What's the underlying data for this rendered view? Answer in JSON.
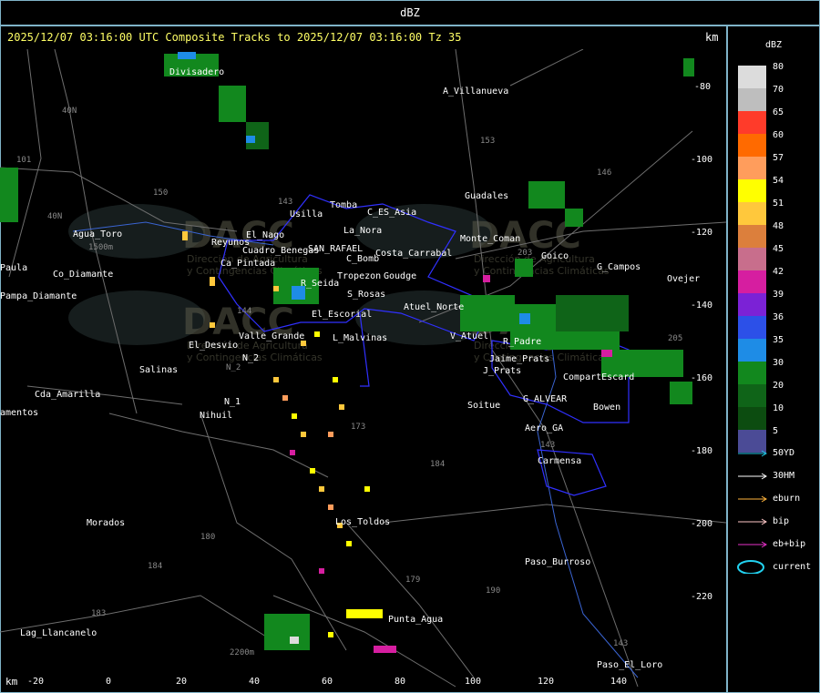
{
  "header": {
    "title": "dBZ"
  },
  "subtitle": "2025/12/07 03:16:00 UTC Composite Tracks to 2025/12/07 03:16:00 Tz 35",
  "axis": {
    "unit": "km",
    "x_ticks": [
      "-20",
      "0",
      "20",
      "40",
      "60",
      "80",
      "100",
      "120",
      "140"
    ],
    "y_ticks": [
      "-80",
      "-100",
      "-120",
      "-140",
      "-160",
      "-180",
      "-200",
      "-220"
    ]
  },
  "watermark": {
    "logo": "DACC",
    "line1": "Dirección de Agricultura",
    "line2": "y Contingencias Climáticas"
  },
  "places": [
    "A_Villanueva",
    "Guadales",
    "Goico",
    "G_Campos",
    "Ovejer",
    "Usilla",
    "Tomba",
    "La_Nora",
    "C_ES_Asia",
    "Cuadro_Benegas",
    "SAN_RAFAEL",
    "C_Bomb",
    "Costa_Carrabal",
    "Tropezon",
    "Goudge",
    "R_Seida",
    "S_Rosas",
    "Atuel_Norte",
    "El_Escorial",
    "Valle_Grande",
    "L_Malvinas",
    "V_Atuel",
    "R_Padre",
    "J_Prats",
    "CompartEscard",
    "G_ALVEAR",
    "Bowen",
    "Soitue",
    "Aero_GA",
    "Carmensa",
    "Los_Toldos",
    "Punta_Agua",
    "Paso_Burroso",
    "Paso_El_Loro",
    "Morados",
    "Lag_Llancanelo",
    "Agua_Toro",
    "Pampa_Diamante",
    "El_Desvio",
    "Salinas",
    "Cda_Amarilla",
    "Nihuil",
    "N_1",
    "N_2",
    "Reyunos",
    "El_Nago",
    "Ca_Pintada",
    "Divisadero",
    "Monte_Coman",
    "Jaime_Prats",
    "Paula",
    "amentos",
    "Co_Diamante"
  ],
  "roads": [
    "40N",
    "40N",
    "101",
    "150",
    "143",
    "153",
    "146",
    "203",
    "144",
    "173",
    "184",
    "179",
    "180",
    "184",
    "183",
    "190",
    "143",
    "205",
    "143",
    "2200m",
    "1500m",
    "N_2"
  ],
  "legend": {
    "title": "dBZ",
    "scale": [
      {
        "label": "80",
        "color": "#dcdcdc"
      },
      {
        "label": "70",
        "color": "#bebebe"
      },
      {
        "label": "65",
        "color": "#ff3b2a"
      },
      {
        "label": "60",
        "color": "#ff6a00"
      },
      {
        "label": "57",
        "color": "#ff9d5c"
      },
      {
        "label": "54",
        "color": "#ffff00"
      },
      {
        "label": "51",
        "color": "#ffc83c"
      },
      {
        "label": "48",
        "color": "#dc7f3c"
      },
      {
        "label": "45",
        "color": "#c86e8c"
      },
      {
        "label": "42",
        "color": "#d61ea0"
      },
      {
        "label": "39",
        "color": "#7b22d6"
      },
      {
        "label": "36",
        "color": "#2c50e8"
      },
      {
        "label": "35",
        "color": "#1e8ce6"
      },
      {
        "label": "30",
        "color": "#12881e"
      },
      {
        "label": "20",
        "color": "#0f6418"
      },
      {
        "label": "10",
        "color": "#0c4c10"
      },
      {
        "label": "5",
        "color": "#4b4b96"
      }
    ],
    "tracks": [
      {
        "label": "50YD",
        "color": "#22c8e6",
        "kind": "arrow"
      },
      {
        "label": "30HM",
        "color": "#ffffff",
        "kind": "arrow"
      },
      {
        "label": "eburn",
        "color": "#ffb43c",
        "kind": "arrow"
      },
      {
        "label": "bip",
        "color": "#ffc8c8",
        "kind": "arrow"
      },
      {
        "label": "eb+bip",
        "color": "#e632c8",
        "kind": "arrow"
      },
      {
        "label": "current",
        "color": "#22d2f0",
        "kind": "ellipse"
      }
    ]
  }
}
